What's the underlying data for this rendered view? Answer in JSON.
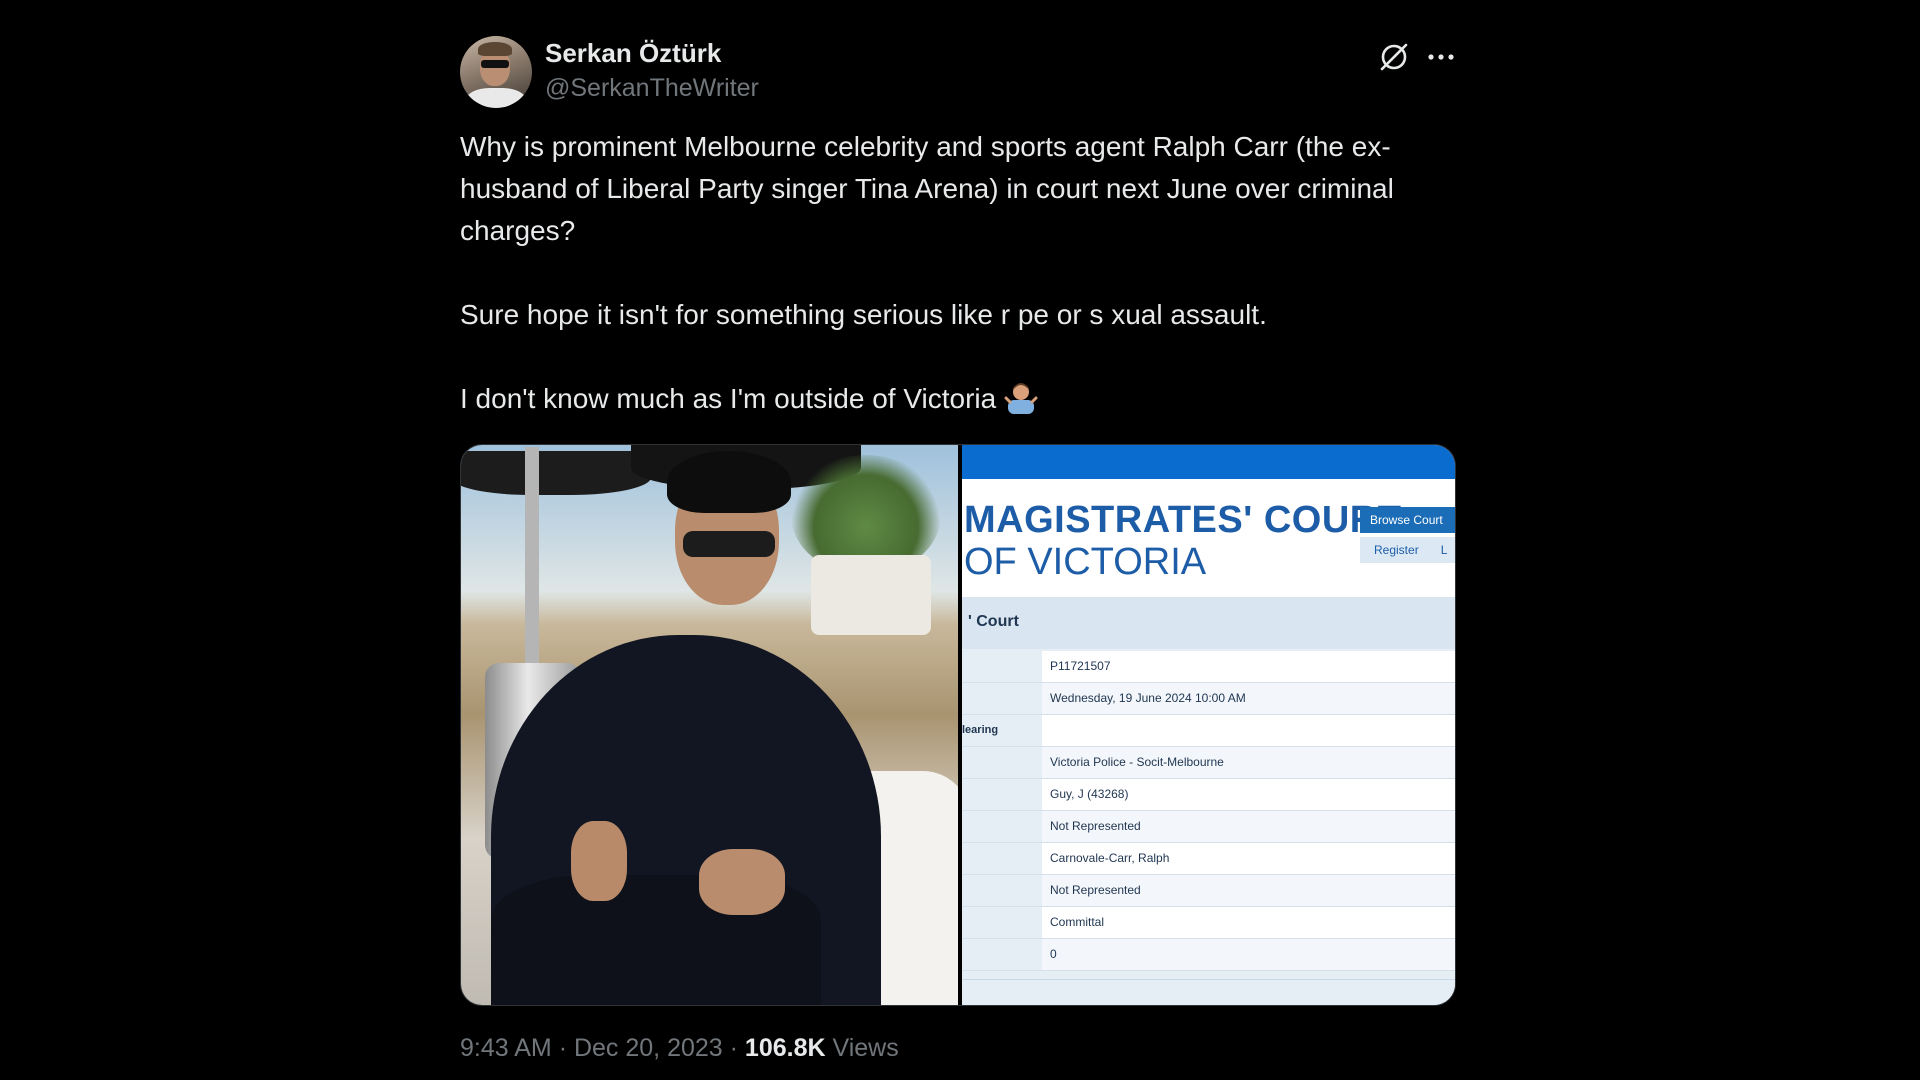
{
  "author": {
    "display_name": "Serkan Öztürk",
    "handle": "@SerkanTheWriter"
  },
  "header_icons": [
    "grok-icon",
    "more-icon"
  ],
  "tweet": {
    "paragraph_1": "Why is prominent Melbourne celebrity and sports agent Ralph Carr (the ex-husband of Liberal Party singer Tina Arena) in court next June over criminal charges?",
    "paragraph_2": "Sure hope it isn't for something serious like r  pe or s  xual assault.",
    "paragraph_3": "I don't know much as I'm outside of Victoria",
    "emoji": "person-shrugging-emoji"
  },
  "court_screenshot": {
    "title_line_1": "MAGISTRATES' COURT",
    "title_line_2": "OF VICTORIA",
    "browse_button": "Browse Court",
    "register_button": "Register",
    "register_button_extra": "L",
    "panel_title": "' Court",
    "rows": [
      {
        "label": "",
        "value": "P11721507"
      },
      {
        "label": "",
        "value": "Wednesday, 19 June 2024 10:00 AM"
      },
      {
        "label": "learing",
        "value": ""
      },
      {
        "label": "",
        "value": "Victoria Police - Socit-Melbourne"
      },
      {
        "label": "",
        "value": "Guy, J (43268)"
      },
      {
        "label": "",
        "value": "Not Represented"
      },
      {
        "label": "",
        "value": "Carnovale-Carr, Ralph"
      },
      {
        "label": "",
        "value": "Not Represented"
      },
      {
        "label": "",
        "value": "Committal"
      },
      {
        "label": "",
        "value": "0"
      }
    ]
  },
  "footer": {
    "time": "9:43 AM",
    "separator": "·",
    "date": "Dec 20, 2023",
    "views_count": "106.8K",
    "views_label": "Views"
  }
}
